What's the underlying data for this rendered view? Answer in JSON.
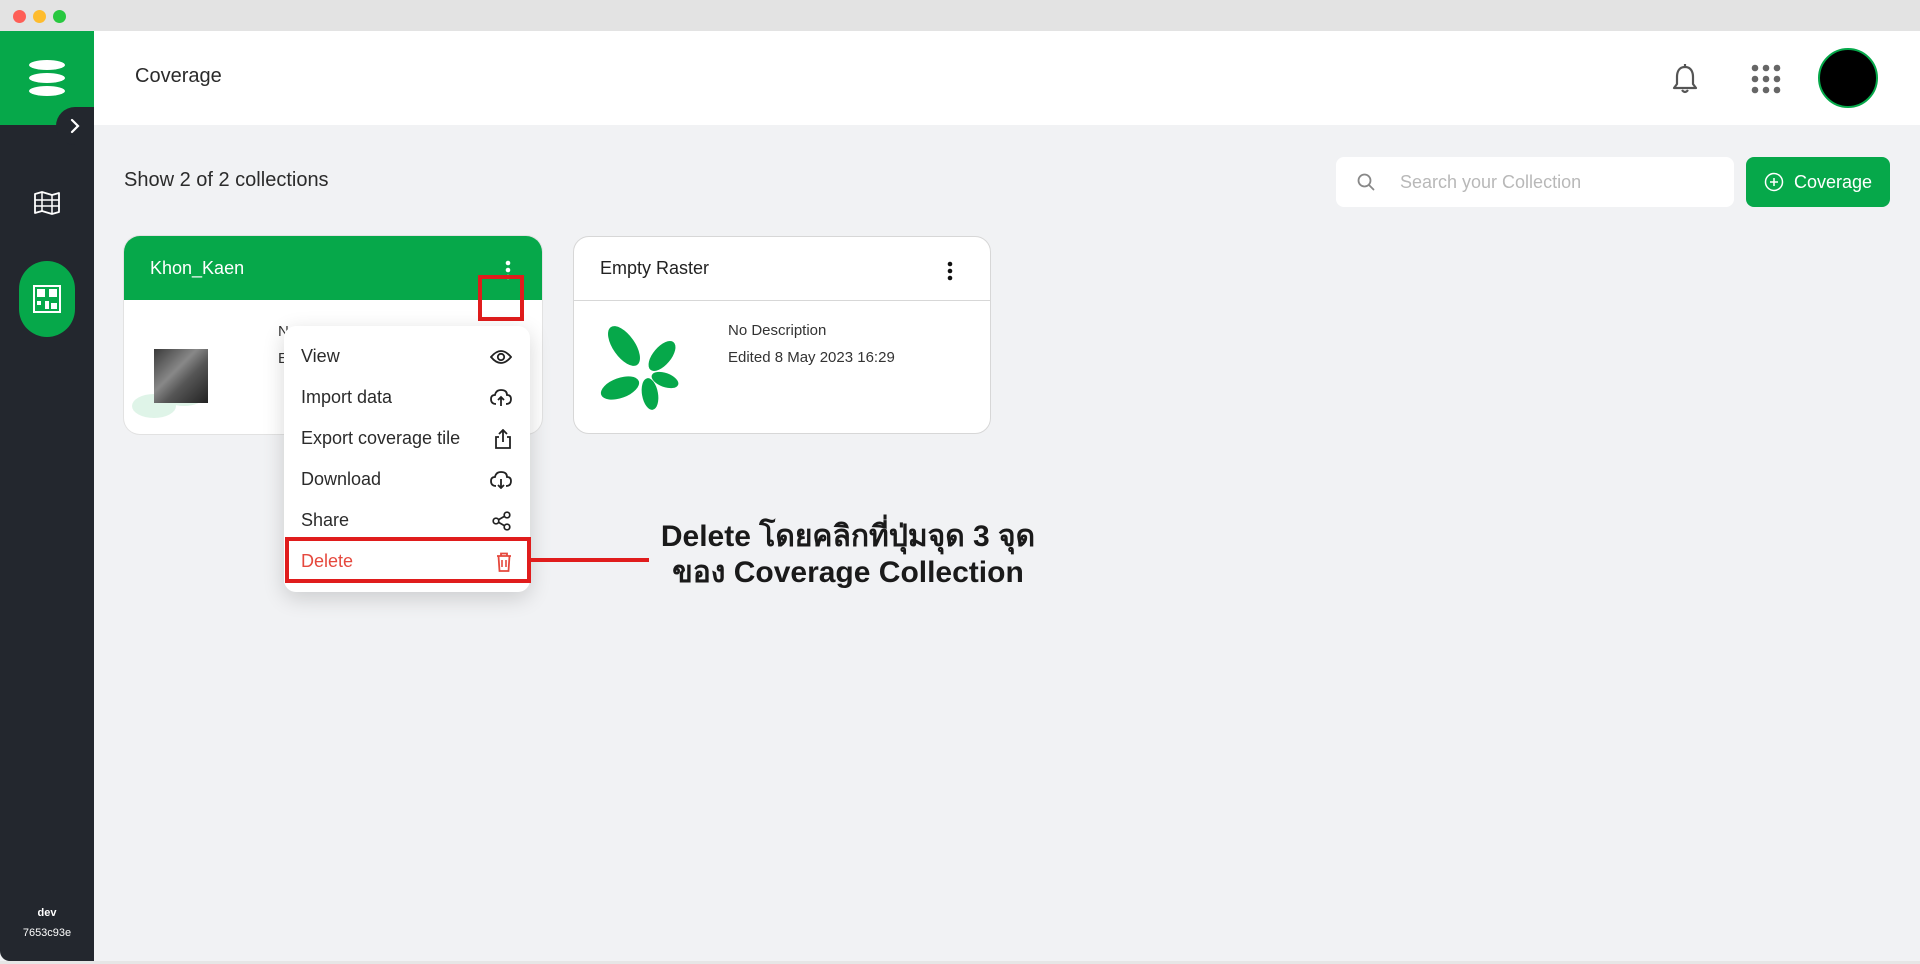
{
  "sidebar": {
    "logo_icon": "company-logo",
    "expand_icon": "chevron-right-icon",
    "items": [
      {
        "icon": "map-icon",
        "active": false
      },
      {
        "icon": "coverage-grid-icon",
        "active": true
      }
    ],
    "footer": {
      "env": "dev",
      "build": "7653c93e"
    }
  },
  "header": {
    "title": "Coverage",
    "bell_icon": "bell-icon",
    "apps_icon": "apps-grid-icon"
  },
  "toolbar": {
    "count_text": "Show 2 of 2 collections",
    "search_placeholder": "Search your Collection",
    "add_button": "Coverage"
  },
  "cards": [
    {
      "title": "Khon_Kaen",
      "meta_line1": "N",
      "meta_line2": "E",
      "selected": true
    },
    {
      "title": "Empty Raster",
      "meta_line1": "No Description",
      "meta_line2": "Edited 8 May 2023 16:29"
    }
  ],
  "menu": {
    "items": [
      {
        "label": "View",
        "icon": "eye-icon"
      },
      {
        "label": "Import data",
        "icon": "cloud-upload-icon"
      },
      {
        "label": "Export coverage tile",
        "icon": "share-out-icon"
      },
      {
        "label": "Download",
        "icon": "cloud-download-icon"
      },
      {
        "label": "Share",
        "icon": "share-nodes-icon"
      },
      {
        "label": "Delete",
        "icon": "trash-icon"
      }
    ]
  },
  "annotation": {
    "line1": "Delete โดยคลิกที่ปุ่มจุด 3 จุด",
    "line2": "ของ Coverage Collection"
  },
  "colors": {
    "brand": "#06a84a",
    "sidebar": "#23272e",
    "danger": "#e5483d",
    "highlight": "#e01c1c"
  }
}
